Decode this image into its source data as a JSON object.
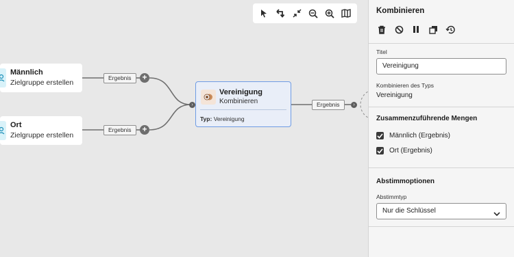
{
  "canvas": {
    "toolbar": {
      "icons": [
        "pointer-icon",
        "undo-icon",
        "collapse-icon",
        "zoom-out-icon",
        "zoom-in-icon",
        "map-icon"
      ]
    },
    "nodes": {
      "maennlich": {
        "title": "Männlich",
        "subtitle": "Zielgruppe erstellen"
      },
      "ort": {
        "title": "Ort",
        "subtitle": "Zielgruppe erstellen"
      },
      "vereinigung": {
        "title": "Vereinigung",
        "subtitle": "Kombinieren",
        "type_label": "Typ:",
        "type_value": "Vereinigung"
      }
    },
    "chips": {
      "ergebnis_top": "Ergebnis",
      "ergebnis_bottom": "Ergebnis",
      "ergebnis_out": "Ergebnis"
    },
    "plus_label": "+",
    "arrow_label": "›"
  },
  "panel": {
    "title": "Kombinieren",
    "actions": [
      "delete-icon",
      "disable-icon",
      "pause-icon",
      "copy-icon",
      "history-icon"
    ],
    "titel_label": "Titel",
    "titel_value": "Vereinigung",
    "type_label": "Kombinieren des Typs",
    "type_value": "Vereinigung",
    "sets_heading": "Zusammenzuführende Mengen",
    "sets": [
      {
        "label": "Männlich (Ergebnis)",
        "checked": true
      },
      {
        "label": "Ort (Ergebnis)",
        "checked": true
      }
    ],
    "reconcile_heading": "Abstimmoptionen",
    "reconcile_label": "Abstimmtyp",
    "reconcile_value": "Nur die Schlüssel"
  },
  "colors": {
    "canvas_bg": "#e8e8e8",
    "selected_border": "#6e9be4",
    "selected_bg": "#e9eef8",
    "audience_icon_bg": "#d9f2f9",
    "combine_icon_bg": "#f4e4d8"
  }
}
